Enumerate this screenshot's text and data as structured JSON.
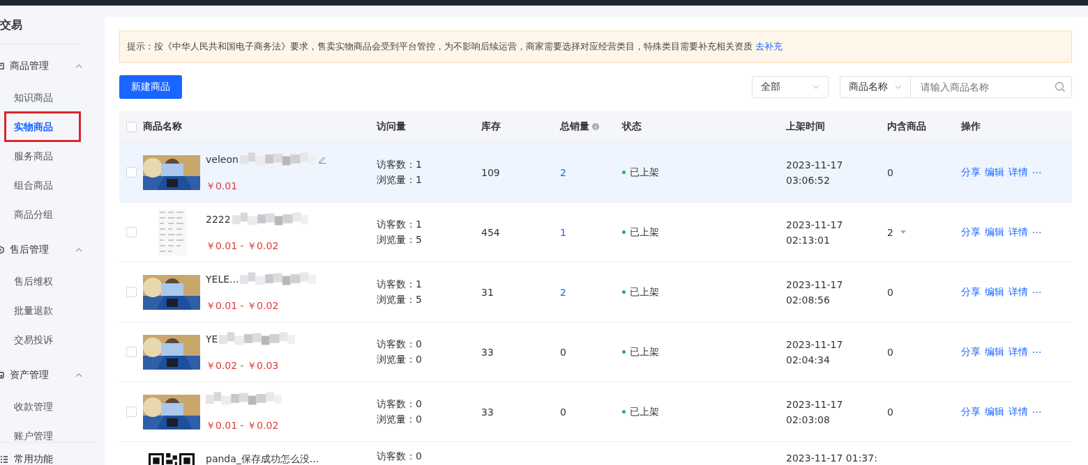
{
  "sidebar": {
    "title": "交易",
    "groups": [
      {
        "label": "商品管理",
        "expanded": true,
        "items": [
          {
            "label": "知识商品",
            "selected": false
          },
          {
            "label": "实物商品",
            "selected": true
          },
          {
            "label": "服务商品",
            "selected": false
          },
          {
            "label": "组合商品",
            "selected": false
          },
          {
            "label": "商品分组",
            "selected": false
          }
        ]
      },
      {
        "label": "售后管理",
        "expanded": true,
        "items": [
          {
            "label": "售后维权",
            "selected": false
          },
          {
            "label": "批量退款",
            "selected": false
          },
          {
            "label": "交易投诉",
            "selected": false
          }
        ]
      },
      {
        "label": "资产管理",
        "expanded": true,
        "items": [
          {
            "label": "收款管理",
            "selected": false
          },
          {
            "label": "账户管理",
            "selected": false
          }
        ]
      }
    ],
    "footer": "常用功能"
  },
  "notice": {
    "text": "提示：按《中华人民共和国电子商务法》要求，售卖实物商品会受到平台管控，为不影响后续运营，商家需要选择对应经营类目，特殊类目需要补充相关资质",
    "link": "去补充"
  },
  "toolbar": {
    "new_button": "新建商品",
    "status_filter": "全部",
    "search_type": "商品名称",
    "search": {
      "placeholder": "请输入商品名称"
    }
  },
  "table": {
    "select_all_checked": false,
    "columns": [
      "商品名称",
      "访问量",
      "库存",
      "总销量",
      "状态",
      "上架时间",
      "内含商品",
      "操作"
    ],
    "rows": [
      {
        "selected": true,
        "checked": false,
        "name": "veleon",
        "edit_icon": true,
        "price": "￥0.01",
        "visitors": "访客数：1",
        "views": "浏览量：1",
        "stock": "109",
        "sales": "2",
        "sales_link": true,
        "status": "已上架",
        "time": "2023-11-17 03:06:52",
        "contains": "0",
        "contains_dropdown": false,
        "actions": [
          "分享",
          "编辑",
          "详情",
          "···"
        ]
      },
      {
        "selected": false,
        "checked": false,
        "kind": "document",
        "name": "2222",
        "edit_icon": false,
        "price": "￥0.01 - ￥0.02",
        "visitors": "访客数：1",
        "views": "浏览量：5",
        "stock": "454",
        "sales": "1",
        "sales_link": true,
        "status": "已上架",
        "time": "2023-11-17 02:13:01",
        "contains": "2",
        "contains_dropdown": true,
        "actions": [
          "分享",
          "编辑",
          "详情",
          "···"
        ]
      },
      {
        "selected": false,
        "checked": false,
        "name": "YELE...",
        "edit_icon": false,
        "price": "￥0.01 - ￥0.02",
        "visitors": "访客数：1",
        "views": "浏览量：5",
        "stock": "31",
        "sales": "2",
        "sales_link": true,
        "status": "已上架",
        "time": "2023-11-17 02:08:56",
        "contains": "0",
        "contains_dropdown": false,
        "actions": [
          "分享",
          "编辑",
          "详情",
          "···"
        ]
      },
      {
        "selected": false,
        "checked": false,
        "name": "YE",
        "edit_icon": false,
        "price": "￥0.02 - ￥0.03",
        "visitors": "访客数：0",
        "views": "浏览量：0",
        "stock": "33",
        "sales": "0",
        "sales_link": false,
        "status": "已上架",
        "time": "2023-11-17 02:04:34",
        "contains": "0",
        "contains_dropdown": false,
        "actions": [
          "分享",
          "编辑",
          "详情",
          "···"
        ]
      },
      {
        "selected": false,
        "checked": false,
        "edit_icon": false,
        "price": "￥0.01 - ￥0.02",
        "visitors": "访客数：0",
        "views": "浏览量：0",
        "stock": "33",
        "sales": "0",
        "sales_link": false,
        "status": "已上架",
        "time": "2023-11-17 02:03:08",
        "contains": "0",
        "contains_dropdown": false,
        "actions": [
          "分享",
          "编辑",
          "详情",
          "···"
        ]
      },
      {
        "selected": false,
        "kind": "qr",
        "name": "panda_保存成功怎么没...",
        "visitors": "访客数：0",
        "time": "2023-11-17 01:37:"
      }
    ]
  }
}
